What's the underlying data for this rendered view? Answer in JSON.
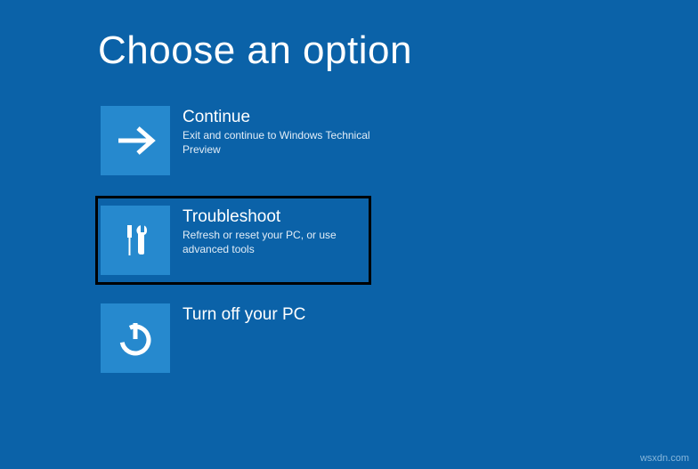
{
  "page": {
    "title": "Choose an option"
  },
  "options": [
    {
      "icon": "arrow-right-icon",
      "title": "Continue",
      "desc": "Exit and continue to Windows Technical Preview"
    },
    {
      "icon": "tools-icon",
      "title": "Troubleshoot",
      "desc": "Refresh or reset your PC, or use advanced tools"
    },
    {
      "icon": "power-icon",
      "title": "Turn off your PC",
      "desc": ""
    }
  ],
  "watermark": "wsxdn.com"
}
